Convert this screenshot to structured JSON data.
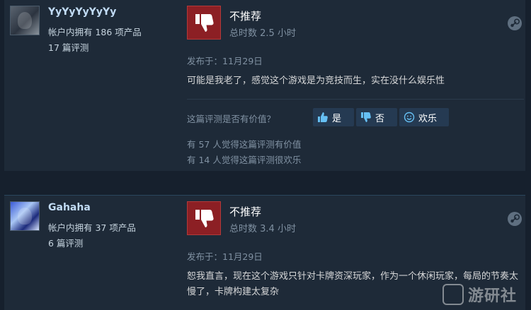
{
  "reviews": [
    {
      "user": {
        "name": "YyYyYyYyYy",
        "products_owned": "帐户内拥有 186 项产品",
        "review_count": "17 篇评测"
      },
      "verdict": "不推荐",
      "playtime": "总时数 2.5 小时",
      "posted": "发布于：11月29日",
      "content": "可能是我老了，感觉这个游戏是为竞技而生，实在没什么娱乐性",
      "helpful_question": "这篇评测是否有价值？",
      "buttons": {
        "yes": "是",
        "no": "否",
        "funny": "欢乐"
      },
      "stats": {
        "helpful": "有 57 人觉得这篇评测有价值",
        "funny": "有 14 人觉得这篇评测很欢乐"
      }
    },
    {
      "user": {
        "name": "Gahaha",
        "products_owned": "帐户内拥有 37 项产品",
        "review_count": "6 篇评测"
      },
      "verdict": "不推荐",
      "playtime": "总时数 3.4 小时",
      "posted": "发布于：11月29日",
      "content": "恕我直言，现在这个游戏只针对卡牌资深玩家，作为一个休闲玩家，每局的节奏太慢了，卡牌构建太复杂"
    }
  ],
  "watermark": "游研社",
  "colors": {
    "background": "#16202d",
    "card": "#1e2a38",
    "thumb_down_bg": "#8c1f24",
    "link_blue": "#66c0f4"
  },
  "icons": {
    "verdict": "thumbs-down-icon",
    "platform": "steam-icon",
    "vote_yes": "thumbs-up-icon",
    "vote_no": "thumbs-down-icon",
    "vote_funny": "smiley-icon"
  }
}
